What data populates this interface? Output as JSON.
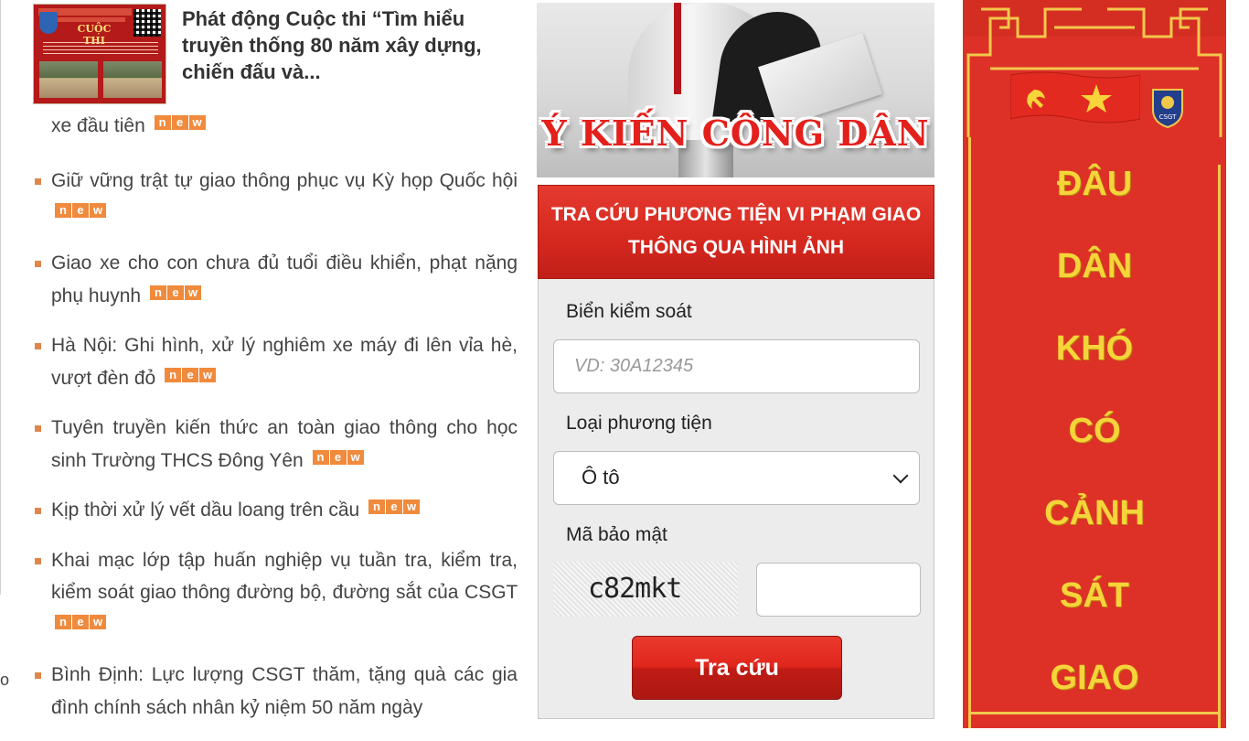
{
  "feature_article": {
    "title": "Phát động Cuộc thi “Tìm hiểu truyền thống 80 năm xây dựng, chiến đấu và...",
    "thumbnail_label": "CUỘC THI"
  },
  "partial_item": "xe đầu tiên",
  "new_badge": [
    "n",
    "e",
    "w"
  ],
  "news_items": [
    "Giữ vững trật tự giao thông phục vụ Kỳ họp Quốc hội",
    "Giao xe cho con chưa đủ tuổi điều khiển, phạt nặng phụ huynh",
    "Hà Nội: Ghi hình, xử lý nghiêm xe máy đi lên vỉa hè, vượt đèn đỏ",
    "Tuyên truyền kiến thức an toàn giao thông cho học sinh Trường THCS Đông Yên",
    "Kịp thời xử lý vết dầu loang trên cầu",
    "Khai mạc lớp tập huấn nghiệp vụ tuần tra, kiểm tra, kiểm soát giao thông đường bộ, đường sắt của CSGT",
    "Bình Định: Lực lượng CSGT thăm, tặng quà các gia đình chính sách nhân kỷ niệm 50 năm ngày"
  ],
  "left_edge_char": "o",
  "banner": {
    "text": "Ý KIẾN CÔNG DÂN"
  },
  "lookup": {
    "title": "TRA CỨU PHƯƠNG TIỆN VI PHẠM GIAO THÔNG QUA HÌNH ẢNH",
    "plate_label": "Biển kiểm soát",
    "plate_placeholder": "VD: 30A12345",
    "vehicle_label": "Loại phương tiện",
    "vehicle_selected": "Ô tô",
    "captcha_label": "Mã bảo mật",
    "captcha_code": "c82mkt",
    "submit_label": "Tra cứu"
  },
  "right_panel": {
    "words": [
      "ĐÂU",
      "DÂN",
      "KHÓ",
      "CÓ",
      "CẢNH",
      "SÁT",
      "GIAO"
    ],
    "emblem_text": "CSGT"
  },
  "colors": {
    "accent_red": "#e0261c",
    "new_badge": "#f08a3c",
    "slogan_yellow": "#f6d43a",
    "panel_red": "#dd3127"
  }
}
